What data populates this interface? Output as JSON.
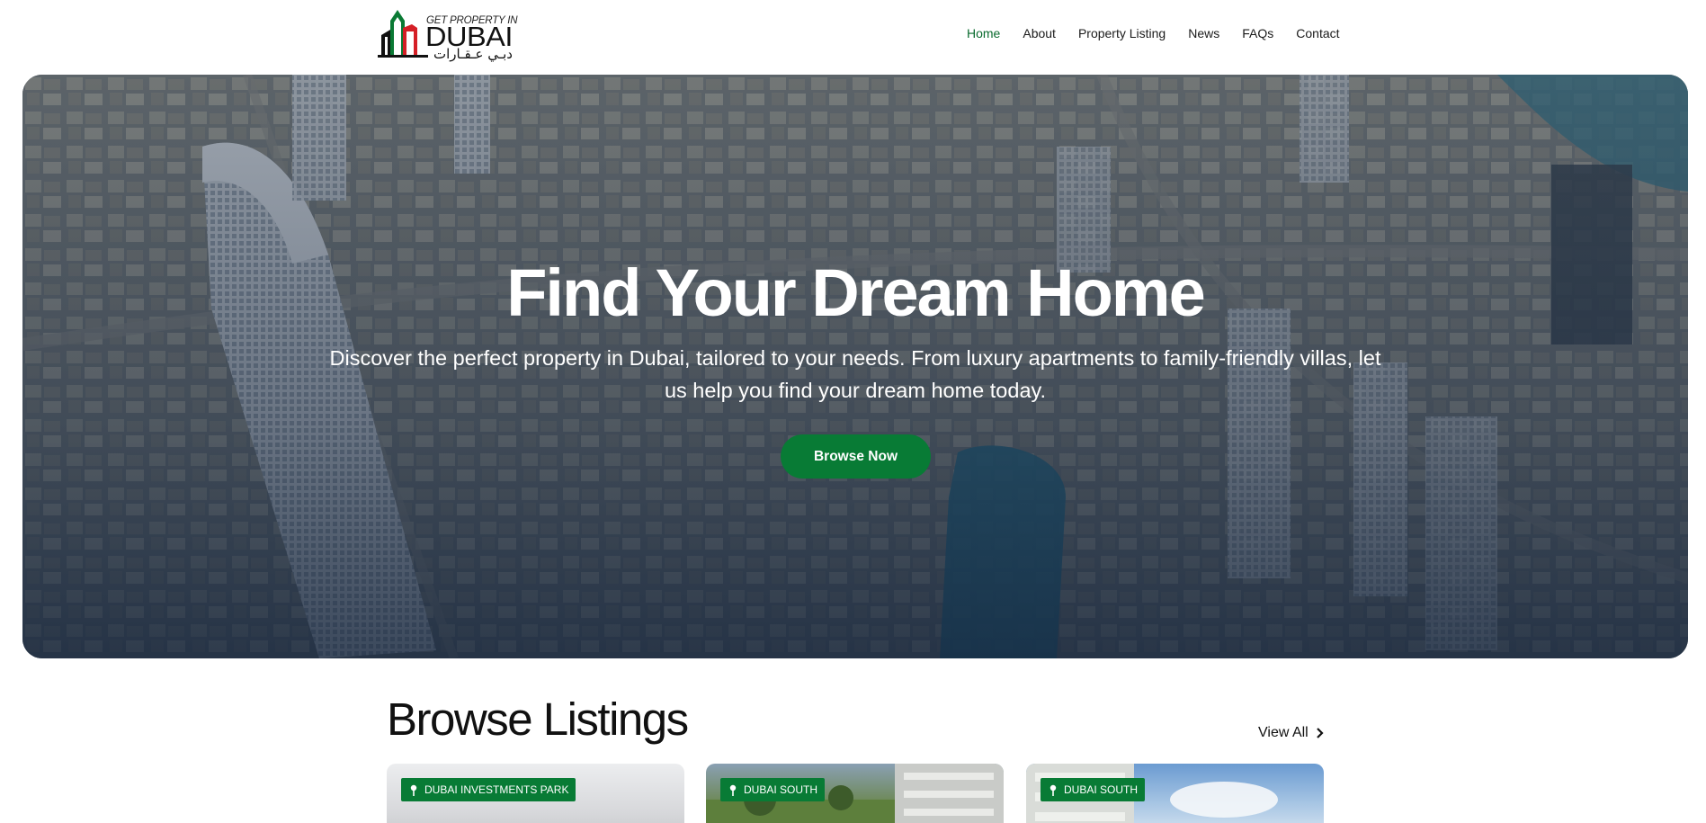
{
  "header": {
    "logo": {
      "tagline": "GET PROPERTY IN",
      "brand": "DUBAI",
      "arabic": "دبـي عـقـارات",
      "colors": {
        "green": "#0a7a34",
        "red": "#d51f26",
        "black": "#111111"
      }
    },
    "nav": [
      {
        "label": "Home",
        "active": true
      },
      {
        "label": "About",
        "active": false
      },
      {
        "label": "Property Listing",
        "active": false
      },
      {
        "label": "News",
        "active": false
      },
      {
        "label": "FAQs",
        "active": false
      },
      {
        "label": "Contact",
        "active": false
      }
    ]
  },
  "hero": {
    "title": "Find Your Dream Home",
    "subtitle": "Discover the perfect property in Dubai, tailored to your needs. From luxury apartments to family-friendly villas, let us help you find your dream home today.",
    "button": "Browse Now"
  },
  "listings": {
    "title": "Browse Listings",
    "view_all": "View All",
    "cards": [
      {
        "location": "DUBAI INVESTMENTS PARK"
      },
      {
        "location": "DUBAI SOUTH"
      },
      {
        "location": "DUBAI SOUTH"
      }
    ]
  },
  "colors": {
    "accent": "#087b35",
    "nav_active": "#0a6b2e",
    "hero_overlay": "#1c2c44"
  },
  "icons": {
    "pin": "location-pin-icon",
    "chevron": "chevron-right-icon"
  }
}
